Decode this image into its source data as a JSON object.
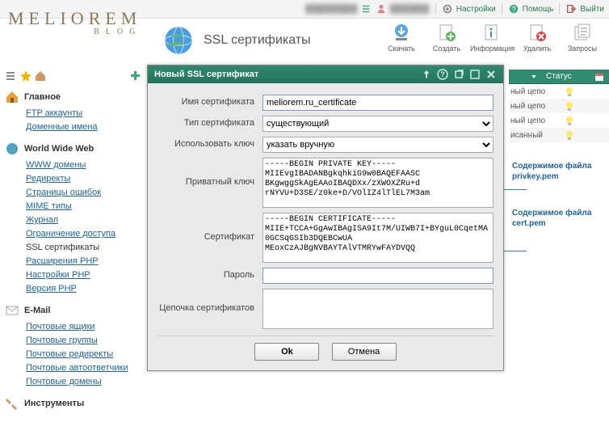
{
  "topbar": {
    "user_blur": "████████",
    "user2_blur": "██████",
    "settings": "Настройки",
    "help": "Помощь",
    "logout": "Выйти"
  },
  "logo": {
    "main": "MELIOREM",
    "sub": "BLOG"
  },
  "header": {
    "title": "SSL сертификаты",
    "tools": {
      "download": "Скачать",
      "create": "Создать",
      "info": "Информация",
      "delete": "Удалить",
      "requests": "Запросы"
    }
  },
  "sidebar": {
    "main": {
      "title": "Главное",
      "items": {
        "ftp": "FTP аккаунты",
        "domains": "Доменные имена"
      }
    },
    "www": {
      "title": "World Wide Web",
      "items": {
        "wwwdom": "WWW домены",
        "redir": "Редиректы",
        "errpages": "Страницы ошибок",
        "mime": "MIME типы",
        "journal": "Журнал",
        "access": "Ограничение доступа",
        "ssl": "SSL сертификаты",
        "phpext": "Расширения PHP",
        "phpset": "Настройки PHP",
        "phpver": "Версия PHP"
      }
    },
    "email": {
      "title": "E-Mail",
      "items": {
        "boxes": "Почтовые ящики",
        "groups": "Почтовые группы",
        "redir": "Почтовые редиректы",
        "autoresp": "Почтовые автоответчики",
        "maildom": "Почтовые домены"
      }
    },
    "tools": {
      "title": "Инструменты"
    }
  },
  "statuscol": {
    "status_head": "Статус",
    "rows": [
      "ный цепо",
      "ный цепо",
      "ный цепо",
      "исанный"
    ],
    "note_priv": "Содержимое файла privkey.pem",
    "note_cert": "Содержимое файла cert.pem"
  },
  "modal": {
    "title": "Новый SSL сертификат",
    "labels": {
      "name": "Имя сертификата",
      "type": "Тип сертификата",
      "usekey": "Использовать ключ",
      "privkey": "Приватный ключ",
      "cert": "Сертификат",
      "password": "Пароль",
      "chain": "Цепочка сертификатов"
    },
    "values": {
      "name": "meliorem.ru_certificate",
      "type": "существующий",
      "usekey": "указать вручную",
      "privkey": "-----BEGIN PRIVATE KEY-----\nMIIEvgIBADANBgkqhkiG9w0BAQEFAASC\nBKgwggSkAgEAAoIBAQDXx/zXWOXZRu+d\nrNYVU+D3SE/z0ke+D/VOlIZ4lTlEL7M3am",
      "cert": "-----BEGIN CERTIFICATE-----\nMIIE+TCCA+GgAwIBAgISA9It7M/UIWB7I+BYguL0CqetMA0GCSqGSIb3DQEBCwUA\nMEoxCzAJBgNVBAYTAlVTMRYwFAYDVQQ",
      "password": "",
      "chain": ""
    },
    "buttons": {
      "ok": "Ok",
      "cancel": "Отмена"
    }
  }
}
